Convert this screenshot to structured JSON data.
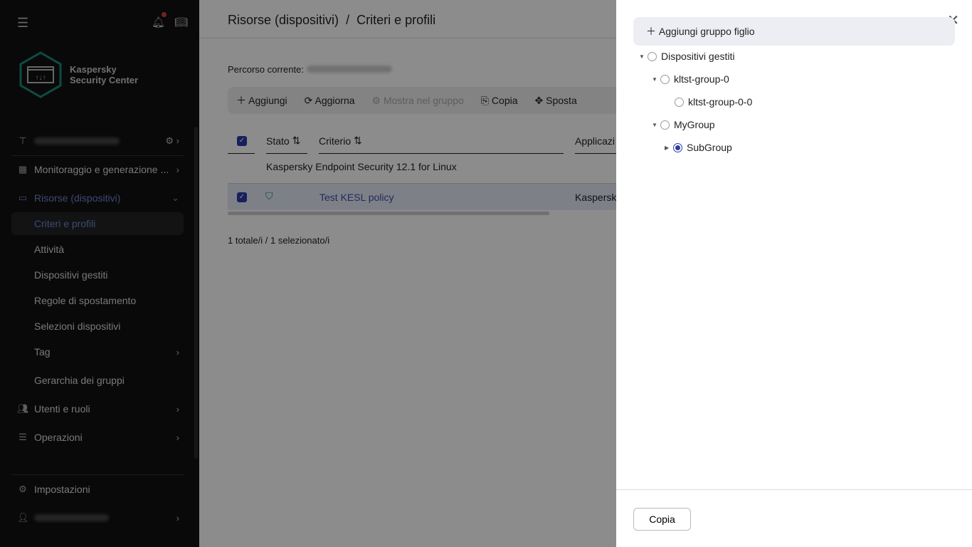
{
  "sidebar": {
    "logo_line1": "Kaspersky",
    "logo_line2": "Security Center",
    "items": [
      {
        "label": "Monitoraggio e generazione ..."
      },
      {
        "label": "Risorse (dispositivi)"
      },
      {
        "label": "Criteri e profili"
      },
      {
        "label": "Attività"
      },
      {
        "label": "Dispositivi gestiti"
      },
      {
        "label": "Regole di spostamento"
      },
      {
        "label": "Selezioni dispositivi"
      },
      {
        "label": "Tag"
      },
      {
        "label": "Gerarchia dei gruppi"
      },
      {
        "label": "Utenti e ruoli"
      },
      {
        "label": "Operazioni"
      },
      {
        "label": "Impostazioni"
      }
    ]
  },
  "header": {
    "breadcrumb1": "Risorse (dispositivi)",
    "sep": "/",
    "breadcrumb2": "Criteri e profili"
  },
  "main": {
    "path_label": "Percorso corrente:",
    "toolbar": {
      "add": "Aggiungi",
      "refresh": "Aggiorna",
      "show_in_group": "Mostra nel gruppo",
      "copy": "Copia",
      "move": "Sposta"
    },
    "columns": [
      "Stato",
      "Criterio",
      "Applicazi"
    ],
    "group_label": "Kaspersky Endpoint Security 12.1 for Linux",
    "row": {
      "name": "Test KESL policy",
      "app": "Kaspersky"
    },
    "total": "1 totale/i / 1 selezionato/i"
  },
  "panel": {
    "add_child": "Aggiungi gruppo figlio",
    "tree": [
      {
        "label": "Dispositivi gestiti",
        "selected": false
      },
      {
        "label": "kltst-group-0",
        "selected": false
      },
      {
        "label": "kltst-group-0-0",
        "selected": false
      },
      {
        "label": "MyGroup",
        "selected": false
      },
      {
        "label": "SubGroup",
        "selected": true
      }
    ],
    "copy_button": "Copia"
  }
}
